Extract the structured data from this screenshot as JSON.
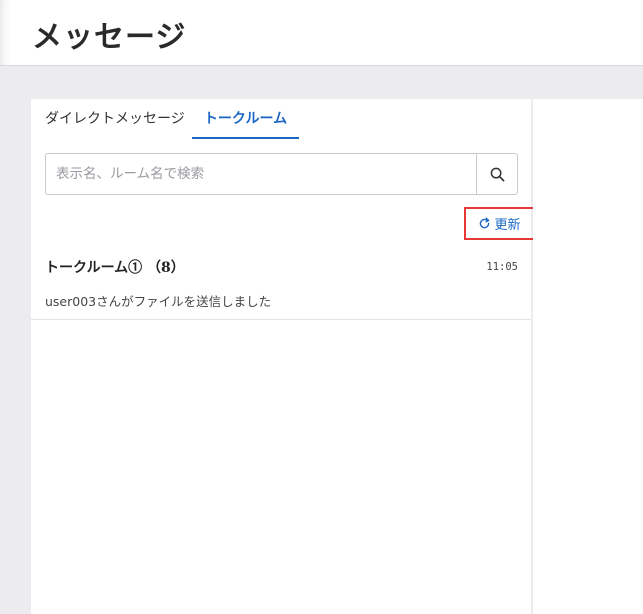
{
  "header": {
    "title": "メッセージ"
  },
  "tabs": [
    {
      "label": "ダイレクトメッセージ",
      "active": false
    },
    {
      "label": "トークルーム",
      "active": true
    }
  ],
  "search": {
    "placeholder": "表示名、ルーム名で検索",
    "value": "",
    "icon": "search-icon"
  },
  "refresh": {
    "label": "更新",
    "icon": "refresh-icon"
  },
  "rooms": [
    {
      "name": "トークルーム①  （8）",
      "time": "11:05",
      "preview": "user003さんがファイルを送信しました"
    }
  ],
  "colors": {
    "accent": "#1a66c5",
    "highlight_border": "#e53935",
    "page_background": "#ececef"
  }
}
